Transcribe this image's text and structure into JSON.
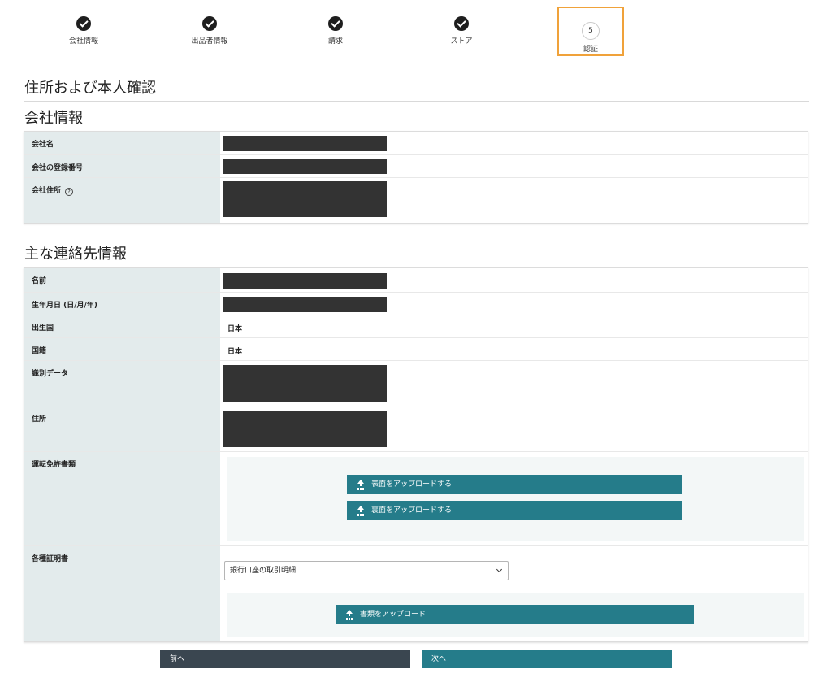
{
  "stepper": {
    "steps": [
      {
        "label": "会社情報"
      },
      {
        "label": "出品者情報"
      },
      {
        "label": "請求"
      },
      {
        "label": "ストア"
      }
    ],
    "active": {
      "number": "5",
      "label": "認証"
    }
  },
  "page_title": "住所および本人確認",
  "company_section": {
    "title": "会社情報",
    "rows": [
      {
        "label": "会社名"
      },
      {
        "label": "会社の登録番号"
      },
      {
        "label": "会社住所"
      }
    ],
    "help_icon": "help-icon"
  },
  "contact_section": {
    "title": "主な連絡先情報",
    "rows": [
      {
        "label": "名前"
      },
      {
        "label": "生年月日 (日/月/年)"
      },
      {
        "label": "出生国",
        "value": "日本"
      },
      {
        "label": "国籍",
        "value": "日本"
      },
      {
        "label": "識別データ"
      },
      {
        "label": "住所"
      },
      {
        "label": "運転免許書類"
      },
      {
        "label": "各種証明書"
      }
    ],
    "upload_front": "表面をアップロードする",
    "upload_back": "裏面をアップロードする",
    "doc_select": "銀行口座の取引明細",
    "upload_doc": "書類をアップロード"
  },
  "nav": {
    "prev": "前へ",
    "next": "次へ"
  },
  "colors": {
    "accent": "#257c8a",
    "active_step_border": "#f0a23a",
    "label_bg": "#e3ebec",
    "prev_button": "#3a4650"
  }
}
